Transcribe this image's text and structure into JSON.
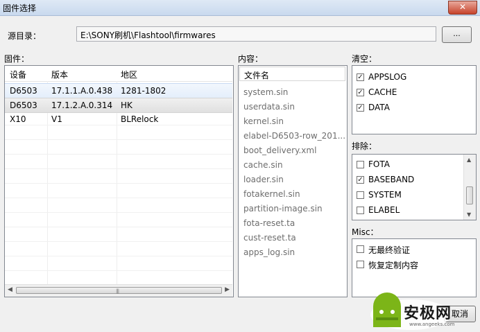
{
  "window": {
    "title": "固件选择",
    "close_glyph": "✕"
  },
  "source": {
    "label": "源目录：",
    "path": "E:\\SONY刷机\\Flashtool\\firmwares",
    "browse_label": "..."
  },
  "firmware": {
    "label": "固件：",
    "columns": [
      "设备",
      "版本",
      "地区"
    ],
    "rows": [
      [
        "D6503",
        "17.1.1.A.0.438",
        "1281-1802"
      ],
      [
        "D6503",
        "17.1.2.A.0.314",
        "HK"
      ],
      [
        "X10",
        "V1",
        "BLRelock"
      ]
    ]
  },
  "content": {
    "label": "内容：",
    "header": "文件名",
    "files": [
      "system.sin",
      "userdata.sin",
      "kernel.sin",
      "elabel-D6503-row_201...",
      "boot_delivery.xml",
      "cache.sin",
      "loader.sin",
      "fotakernel.sin",
      "partition-image.sin",
      "fota-reset.ta",
      "cust-reset.ta",
      "apps_log.sin"
    ]
  },
  "wipe": {
    "label": "清空：",
    "items": [
      {
        "label": "APPSLOG",
        "checked": true,
        "mark": "✓"
      },
      {
        "label": "CACHE",
        "checked": true,
        "mark": "✓"
      },
      {
        "label": "DATA",
        "checked": true,
        "mark": "✓"
      }
    ]
  },
  "exclude": {
    "label": "排除：",
    "items": [
      {
        "label": "FOTA",
        "checked": false,
        "mark": ""
      },
      {
        "label": "BASEBAND",
        "checked": true,
        "mark": "✓"
      },
      {
        "label": "SYSTEM",
        "checked": false,
        "mark": ""
      },
      {
        "label": "ELABEL",
        "checked": false,
        "mark": ""
      }
    ]
  },
  "misc": {
    "label": "Misc：",
    "items": [
      {
        "label": "无最终验证",
        "checked": false,
        "mark": ""
      },
      {
        "label": "恢复定制内容",
        "checked": false,
        "mark": ""
      }
    ]
  },
  "footer": {
    "cancel_label": "取消"
  },
  "watermark": {
    "text": "安极网",
    "url": "www.angeeks.com"
  }
}
